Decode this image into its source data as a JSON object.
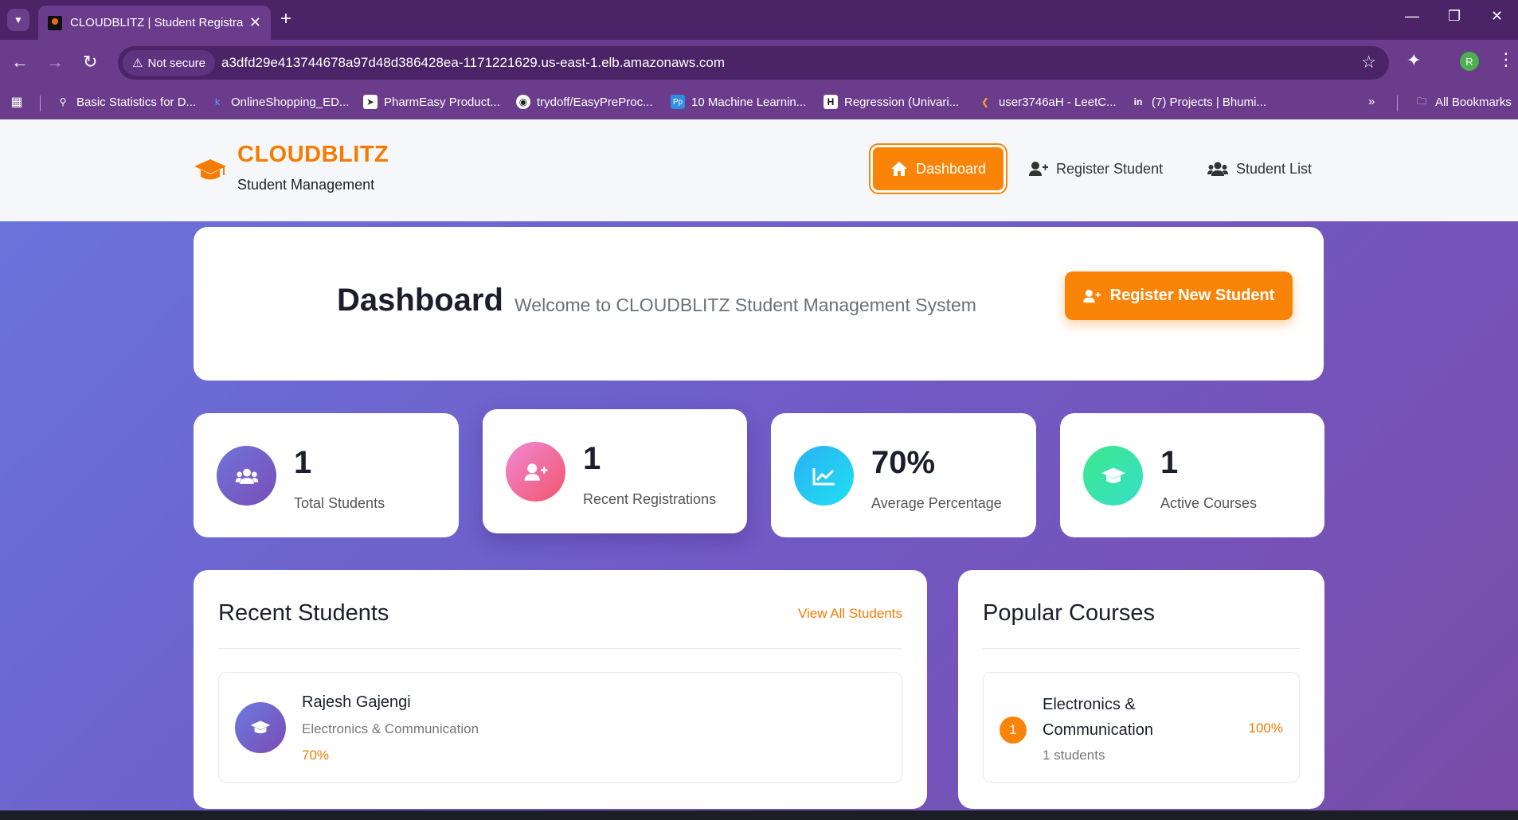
{
  "browser": {
    "tab_title": "CLOUDBLITZ | Student Registrat",
    "security_label": "Not secure",
    "url": "a3dfd29e413744678a97d48d386428ea-1171221629.us-east-1.elb.amazonaws.com",
    "profile_initial": "R",
    "bookmarks": [
      "Basic Statistics for D...",
      "OnlineShopping_ED...",
      "PharmEasy Product...",
      "trydoff/EasyPreProc...",
      "10 Machine Learnin...",
      "Regression (Univari...",
      "user3746aH - LeetC...",
      "(7) Projects | Bhumi..."
    ],
    "all_bookmarks": "All Bookmarks"
  },
  "header": {
    "brand": "CLOUDBLITZ",
    "subtitle": "Student Management",
    "nav": {
      "dashboard": "Dashboard",
      "register": "Register Student",
      "list": "Student List"
    }
  },
  "dashboard": {
    "title": "Dashboard",
    "welcome": "Welcome to CLOUDBLITZ Student Management System",
    "cta": "Register New Student"
  },
  "stats": [
    {
      "value": "1",
      "label": "Total Students",
      "icon": "users-icon",
      "color": "#7561c8"
    },
    {
      "value": "1",
      "label": "Recent Registrations",
      "icon": "user-plus-icon",
      "color": "#f0627e"
    },
    {
      "value": "70%",
      "label": "Average Percentage",
      "icon": "chart-line-icon",
      "color": "#22c3f3"
    },
    {
      "value": "1",
      "label": "Active Courses",
      "icon": "graduation-cap-icon",
      "color": "#3fe3b0"
    }
  ],
  "recent_students": {
    "title": "Recent Students",
    "link": "View All Students",
    "items": [
      {
        "name": "Rajesh Gajengi",
        "course": "Electronics & Communication",
        "percentage": "70%"
      }
    ]
  },
  "popular_courses": {
    "title": "Popular Courses",
    "items": [
      {
        "rank": "1",
        "name": "Electronics & Communication",
        "students": "1 students",
        "percentage": "100%"
      }
    ]
  },
  "colors": {
    "accent": "#f98408",
    "brand": "#f57c00"
  }
}
